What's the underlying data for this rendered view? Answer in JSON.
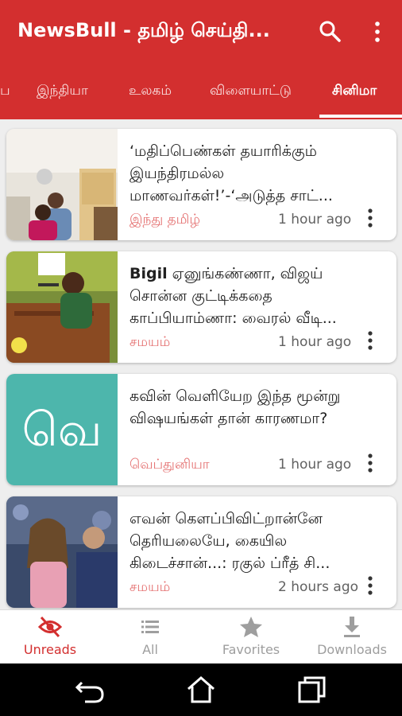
{
  "app_bar": {
    "title": "NewsBull - தமிழ் செய்தி..."
  },
  "tabs": [
    {
      "label": "ப"
    },
    {
      "label": "இந்தியா"
    },
    {
      "label": "உலகம்"
    },
    {
      "label": "விளையாட்டு"
    },
    {
      "label": "சினிமா"
    }
  ],
  "articles": [
    {
      "title": "‘மதிப்பெண்கள் தயாரிக்கும் இயந்திரமல்ல மாணவர்கள்!’-‘அடுத்த சாட்...",
      "source": "இந்து தமிழ்",
      "time": "1 hour ago"
    },
    {
      "title_bold": "Bigil",
      "title": " ஏனுங்கண்ணா, விஜய் சொன்ன குட்டிக்கதை காப்பியாம்ணா: வைரல் வீடி...",
      "source": "சமயம்",
      "time": "1 hour ago"
    },
    {
      "thumb_letter": "வெ",
      "title": "கவின் வெளியேற இந்த மூன்று விஷயங்கள் தான் காரணமா?",
      "source": "வெப்துனியா",
      "time": "1 hour ago"
    },
    {
      "title": "எவன் கெளப்பிவிட்றான்னே தெரியலையே, கையில கிடைச்சான்...: ரகுல் ப்ரீத் சி...",
      "source": "சமயம்",
      "time": "2 hours ago"
    }
  ],
  "bottom_nav": [
    {
      "label": "Unreads",
      "icon": "eye-off-icon"
    },
    {
      "label": "All",
      "icon": "list-icon"
    },
    {
      "label": "Favorites",
      "icon": "star-icon"
    },
    {
      "label": "Downloads",
      "icon": "download-icon"
    }
  ],
  "colors": {
    "primary": "#d32f2f",
    "source": "#e57373",
    "thumb_teal": "#4db6ac"
  }
}
